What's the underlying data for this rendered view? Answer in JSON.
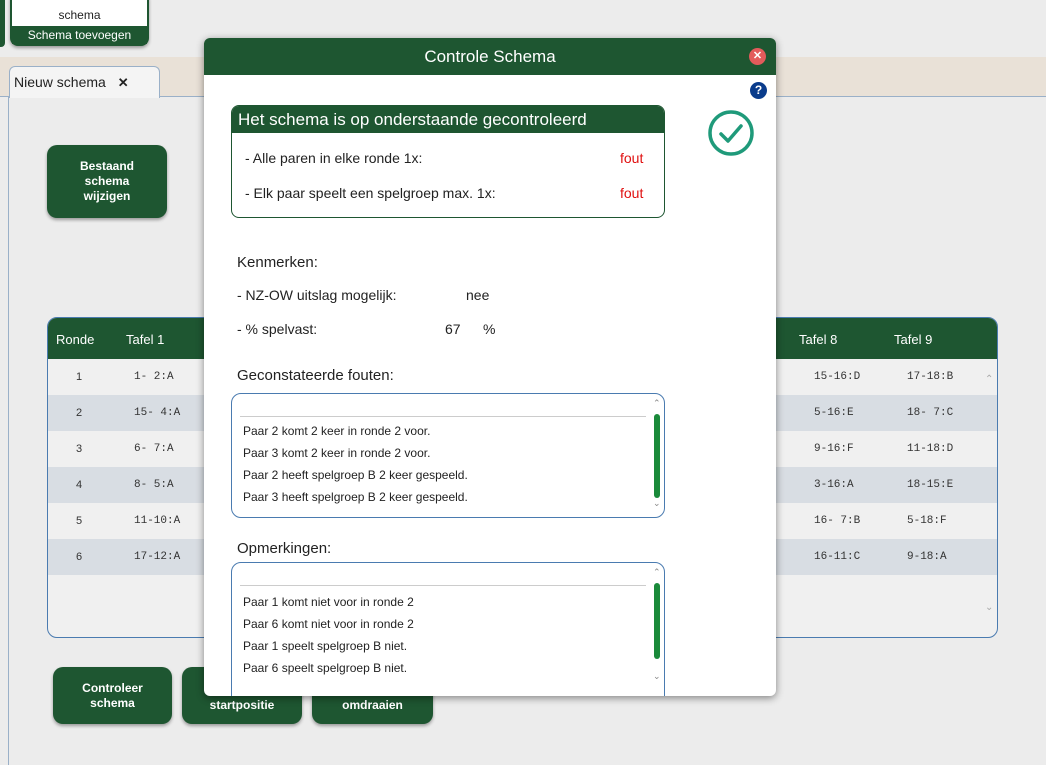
{
  "top_button": {
    "line1": "schema",
    "line2": "Schema toevoegen"
  },
  "tab": {
    "label": "Nieuw schema",
    "close": "✕"
  },
  "left_button": {
    "l1": "Bestaand",
    "l2": "schema",
    "l3": "wijzigen"
  },
  "grid": {
    "headers": {
      "ronde": "Ronde",
      "t1": "Tafel 1",
      "t8": "Tafel 8",
      "t9": "Tafel 9"
    },
    "rows": [
      {
        "ronde": "1",
        "t1": "1- 2:A",
        "t8": "15-16:D",
        "t9": "17-18:B"
      },
      {
        "ronde": "2",
        "t1": "15- 4:A",
        "t8": "5-16:E",
        "t9": "18- 7:C"
      },
      {
        "ronde": "3",
        "t1": "6- 7:A",
        "t8": "9-16:F",
        "t9": "11-18:D"
      },
      {
        "ronde": "4",
        "t1": "8- 5:A",
        "t8": "3-16:A",
        "t9": "18-15:E"
      },
      {
        "ronde": "5",
        "t1": "11-10:A",
        "t8": "16- 7:B",
        "t9": "5-18:F"
      },
      {
        "ronde": "6",
        "t1": "17-12:A",
        "t8": "16-11:C",
        "t9": "9-18:A"
      }
    ]
  },
  "bottom_buttons": {
    "controleer_l1": "Controleer",
    "controleer_l2": "schema",
    "startpositie": "startpositie",
    "omdraaien": "omdraaien"
  },
  "modal": {
    "title": "Controle Schema",
    "check_box": {
      "title": "Het schema is op onderstaande gecontroleerd",
      "item1_label": "- Alle paren in elke ronde 1x:",
      "item1_value": "fout",
      "item2_label": "- Elk paar speelt een spelgroep max. 1x:",
      "item2_value": "fout"
    },
    "kenmerken": {
      "heading": "Kenmerken:",
      "nzow_label": "- NZ-OW uitslag mogelijk:",
      "nzow_value": "nee",
      "spelvast_label": "- % spelvast:",
      "spelvast_value": "67",
      "spelvast_unit": "%"
    },
    "fouten": {
      "heading": "Geconstateerde fouten:",
      "items": [
        "Paar 2 komt 2 keer in ronde 2 voor.",
        "Paar 3 komt 2 keer in ronde 2 voor.",
        "Paar 2 heeft spelgroep B 2 keer gespeeld.",
        "Paar 3 heeft spelgroep B 2 keer gespeeld."
      ]
    },
    "opmerkingen": {
      "heading": "Opmerkingen:",
      "items": [
        "Paar 1 komt niet voor in ronde 2",
        "Paar 6 komt niet voor in ronde 2",
        "Paar 1 speelt spelgroep B niet.",
        "Paar 6 speelt spelgroep B niet."
      ]
    }
  },
  "colors": {
    "brand": "#1e5631",
    "error": "#e01010",
    "help": "#0a3c8c",
    "check": "#1f9a7a"
  }
}
